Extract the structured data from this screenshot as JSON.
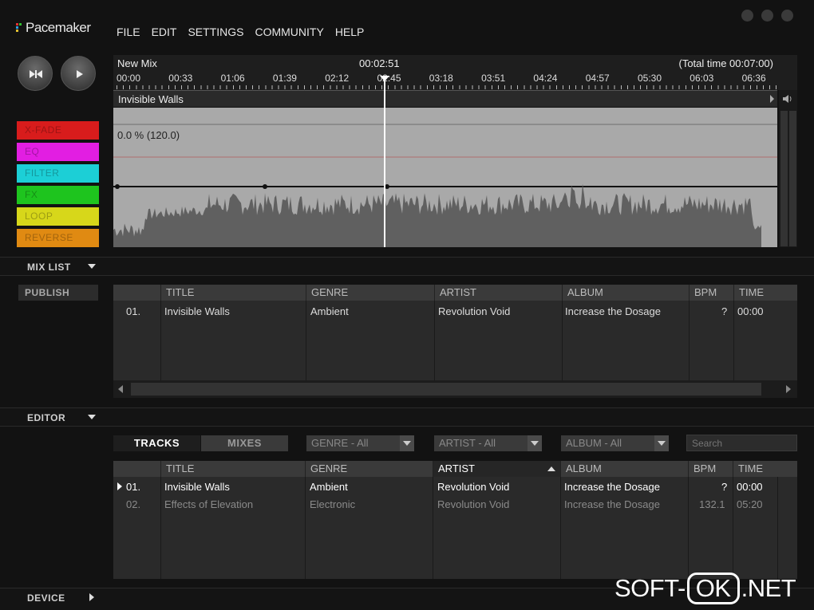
{
  "app": {
    "logo": "Pacemaker"
  },
  "menu": [
    "FILE",
    "EDIT",
    "SETTINGS",
    "COMMUNITY",
    "HELP"
  ],
  "timeline": {
    "mix_name": "New Mix",
    "current_time": "00:02:51",
    "total_time": "(Total time 00:07:00)",
    "ticks": [
      "00:00",
      "00:33",
      "01:06",
      "01:39",
      "02:12",
      "02:45",
      "03:18",
      "03:51",
      "04:24",
      "04:57",
      "05:30",
      "06:03",
      "06:36"
    ]
  },
  "track": {
    "name": "Invisible Walls",
    "tempo": "0.0 % (120.0)"
  },
  "effects": [
    {
      "label": "X-FADE",
      "color": "#d81c1c"
    },
    {
      "label": "EQ",
      "color": "#e21ee2"
    },
    {
      "label": "FILTER",
      "color": "#1ccfd6"
    },
    {
      "label": "FX",
      "color": "#1ec41e"
    },
    {
      "label": "LOOP",
      "color": "#d7d71a"
    },
    {
      "label": "REVERSE",
      "color": "#e08a12"
    }
  ],
  "mix_list": {
    "section_label": "MIX LIST",
    "publish_label": "PUBLISH",
    "columns": [
      "TITLE",
      "GENRE",
      "ARTIST",
      "ALBUM",
      "BPM",
      "TIME"
    ],
    "rows": [
      {
        "num": "01.",
        "title": "Invisible Walls",
        "genre": "Ambient",
        "artist": "Revolution Void",
        "album": "Increase the Dosage",
        "bpm": "?",
        "time": "00:00"
      }
    ]
  },
  "editor": {
    "section_label": "EDITOR",
    "tabs": [
      "TRACKS",
      "MIXES"
    ],
    "filters": [
      "GENRE - All",
      "ARTIST - All",
      "ALBUM - All"
    ],
    "search_placeholder": "Search",
    "columns": [
      "TITLE",
      "GENRE",
      "ARTIST",
      "ALBUM",
      "BPM",
      "TIME"
    ],
    "rows": [
      {
        "num": "01.",
        "title": "Invisible Walls",
        "genre": "Ambient",
        "artist": "Revolution Void",
        "album": "Increase the Dosage",
        "bpm": "?",
        "time": "00:00"
      },
      {
        "num": "02.",
        "title": "Effects of Elevation",
        "genre": "Electronic",
        "artist": "Revolution Void",
        "album": "Increase the Dosage",
        "bpm": "132.1",
        "time": "05:20"
      }
    ]
  },
  "device": {
    "section_label": "DEVICE"
  },
  "watermark": {
    "left": "SOFT-",
    "box": "OK",
    "right": ".NET"
  }
}
